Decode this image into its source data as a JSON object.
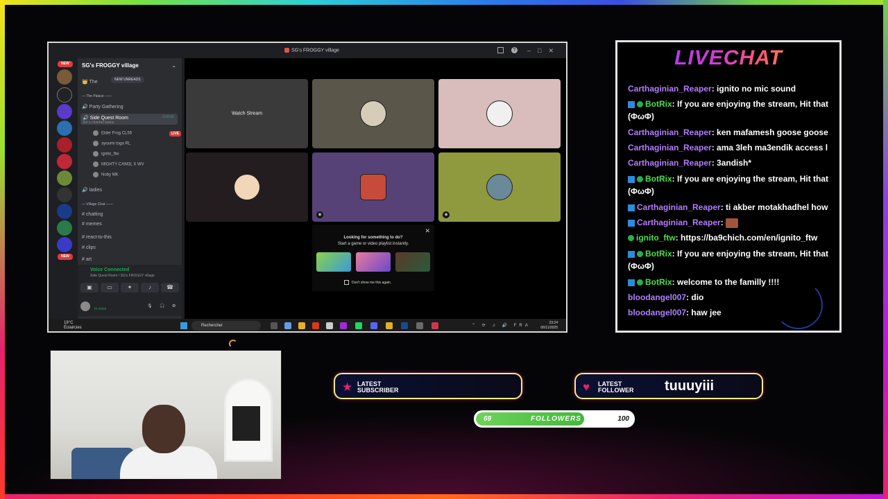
{
  "discord": {
    "window_title": "SG's FROGGY village",
    "server_name": "SG's FROGGY village",
    "new_badge": "NEW",
    "new_unreads": "NEW UNREADS",
    "channels": {
      "the": "The",
      "palace": "The Palace",
      "party": "Party Gathering",
      "side_quest": "Side Quest Room",
      "side_quest_status": "Set a channel status",
      "side_quest_timer": "3:08:56",
      "ladies": "ladies",
      "village_chat": "Village Chat",
      "chatting": "chatting",
      "memes": "memes",
      "react": "react-to-this",
      "clips": "clips",
      "art": "art"
    },
    "voice_users": [
      {
        "name": "Elder Frog",
        "tag": "CL56"
      },
      {
        "name": "ayoumi toga",
        "tag": "RL"
      },
      {
        "name": "ignito_ftw",
        "tag": ""
      },
      {
        "name": "MIGHTY CAM3L X",
        "tag": "WV"
      },
      {
        "name": "Noby",
        "tag": "MK"
      }
    ],
    "live_badge": "LIVE",
    "voice_connected": "Voice Connected",
    "voice_location": "Side Quest Room / SG's FROGGY village",
    "user_status": "In voice",
    "stage": {
      "watch_stream": "Watch Stream",
      "suggest_title": "Looking for something to do?",
      "suggest_sub": "Start a game or video playlist instantly.",
      "suggest_check": "Don't show me this again.",
      "close": "✕"
    },
    "taskbar": {
      "temp": "18°C",
      "weather": "Éclaircies",
      "search": "Rechercher",
      "lang": "FRA",
      "time": "23:24",
      "date": "06/11/2025"
    }
  },
  "livechat": {
    "title": "LIVECHAT",
    "messages": [
      {
        "user": "Carthaginian_Reaper",
        "text": ": ignito no mic sound"
      },
      {
        "user": "BotRix",
        "text": ": If you are enjoying the stream, Hit that",
        "cont": "(ΦωΦ)"
      },
      {
        "user": "Carthaginian_Reaper",
        "text": ": ken mafamesh goose goose"
      },
      {
        "user": "Carthaginian_Reaper",
        "text": ": ama 3leh ma3endik access l"
      },
      {
        "user": "Carthaginian_Reaper",
        "text": ": 3andish*"
      },
      {
        "user": "BotRix",
        "text": ": If you are enjoying the stream, Hit that",
        "cont": "(ΦωΦ)"
      },
      {
        "user": "Carthaginian_Reaper",
        "text": ": ti akber motakhadhel how"
      },
      {
        "user": "Carthaginian_Reaper",
        "text": ":"
      },
      {
        "user": "ignito_ftw",
        "text": ": https://ba9chich.com/en/ignito_ftw"
      },
      {
        "user": "BotRix",
        "text": ": If you are enjoying the stream, Hit that",
        "cont": "(ΦωΦ)"
      },
      {
        "user": "BotRix",
        "text": ": welcome to the familly !!!!"
      },
      {
        "user": "bloodangel007",
        "text": ": dio"
      },
      {
        "user": "bloodangel007",
        "text": ": haw jee"
      }
    ]
  },
  "alerts": {
    "subscriber_label_1": "LATEST",
    "subscriber_label_2": "SUBSCRIBER",
    "subscriber_value": "",
    "follower_label_1": "LATEST",
    "follower_label_2": "FOLLOWER",
    "follower_value": "tuuuyiii"
  },
  "goal": {
    "current": "69",
    "label": "FOLLOWERS",
    "max": "100",
    "progress": 0.69
  },
  "colors": {
    "chat_user_purple": "#b47cff",
    "chat_user_green": "#4be04b",
    "accent_pink": "#e8216e",
    "goal_green": "#42b83a"
  }
}
